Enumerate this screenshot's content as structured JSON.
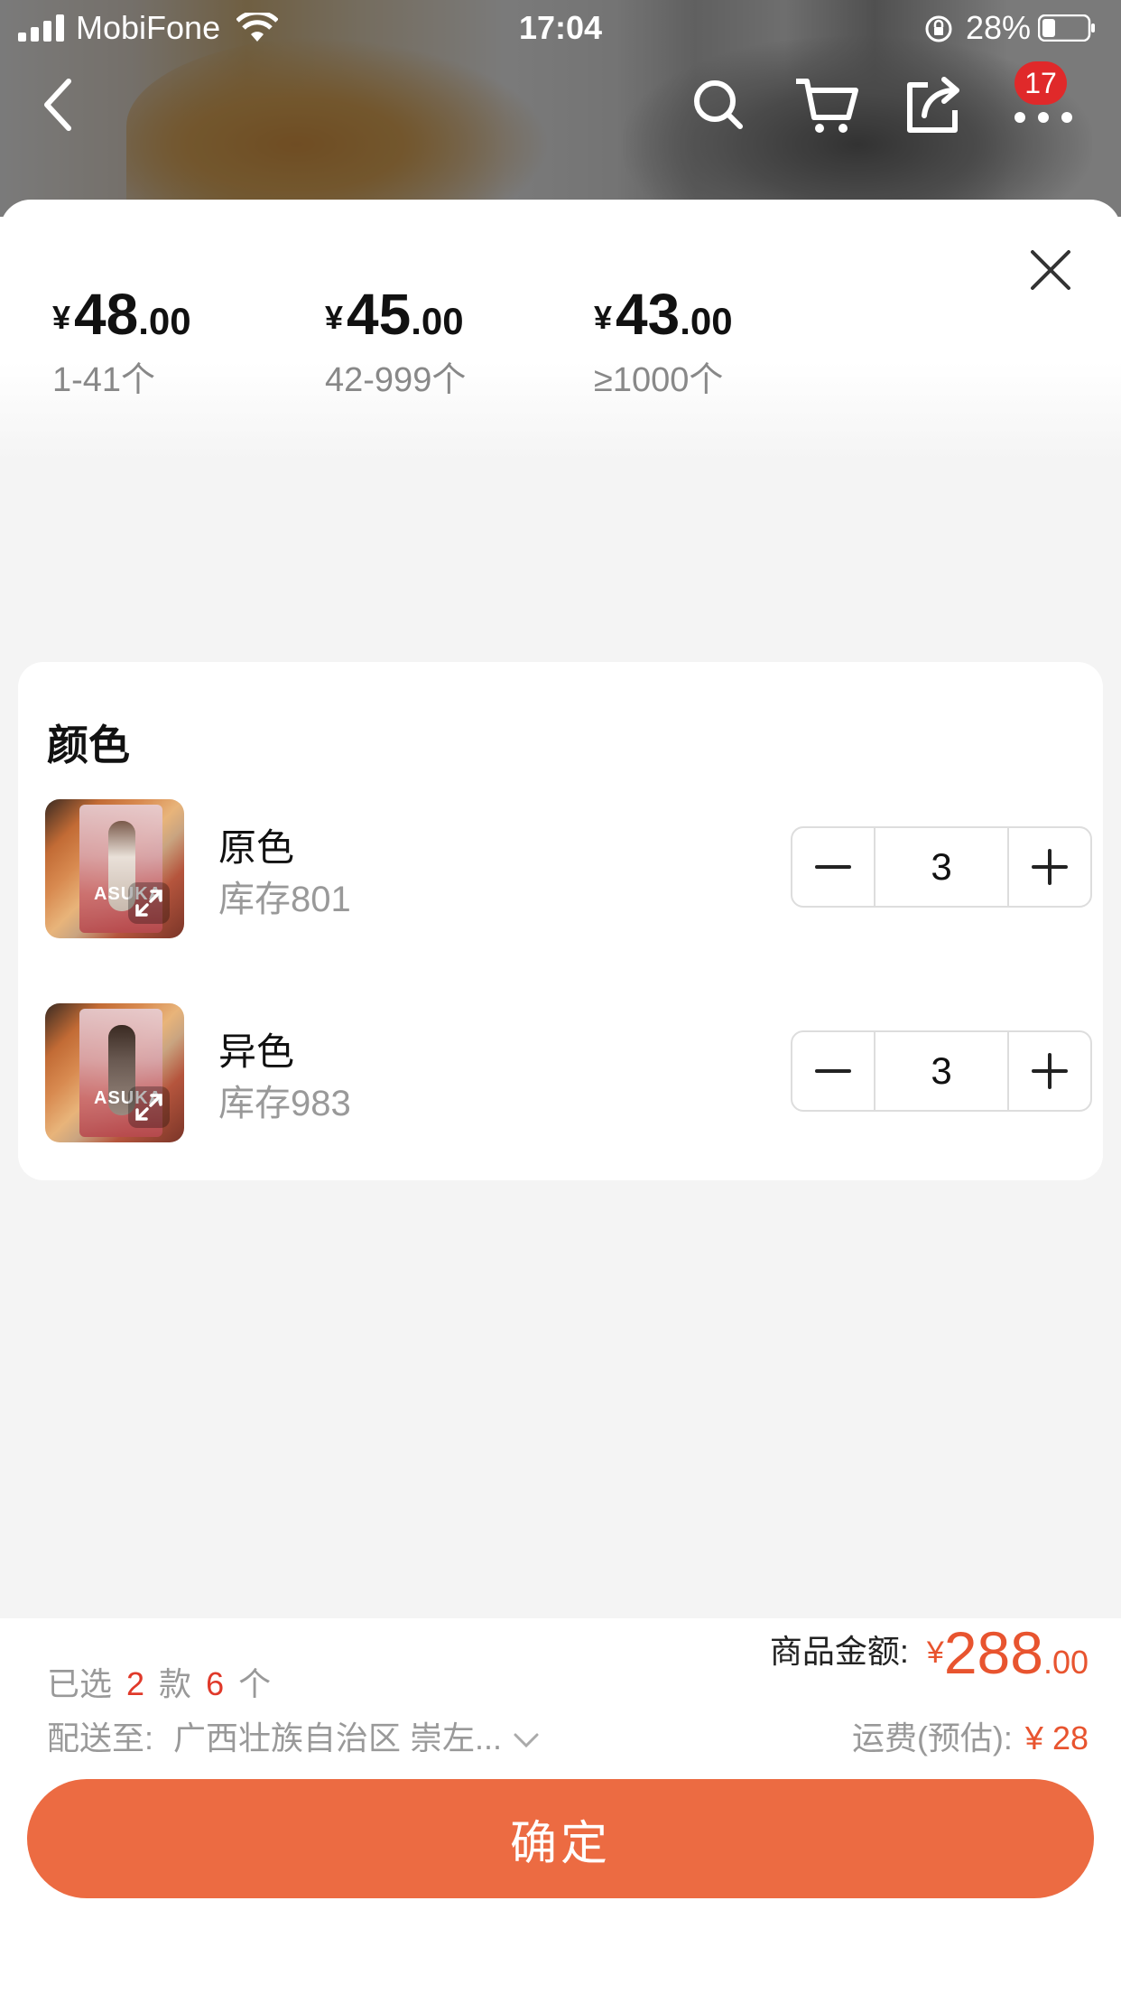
{
  "status_bar": {
    "carrier": "MobiFone",
    "time": "17:04",
    "battery": "28%"
  },
  "nav": {
    "cart_badge": "17"
  },
  "price_tiers": [
    {
      "currency": "¥",
      "integer": "48",
      "decimal": ".00",
      "range": "1-41个"
    },
    {
      "currency": "¥",
      "integer": "45",
      "decimal": ".00",
      "range": "42-999个"
    },
    {
      "currency": "¥",
      "integer": "43",
      "decimal": ".00",
      "range": "≥1000个"
    }
  ],
  "color_section": {
    "title": "颜色",
    "items": [
      {
        "name": "原色",
        "stock": "库存801",
        "quantity": "3",
        "thumb_text": "ASUKA"
      },
      {
        "name": "异色",
        "stock": "库存983",
        "quantity": "3",
        "thumb_text": "ASUKA"
      }
    ]
  },
  "summary": {
    "selected_prefix": "已选",
    "selected_styles": "2",
    "styles_unit": "款",
    "selected_count": "6",
    "count_unit": "个",
    "ship_label": "配送至:",
    "ship_address": "广西壮族自治区 崇左...",
    "amount_label": "商品金额:",
    "amount_currency": "¥",
    "amount_integer": "288",
    "amount_decimal": ".00",
    "fee_label": "运费(预估):",
    "fee_value": "¥ 28"
  },
  "confirm_label": "确定",
  "colors": {
    "accent": "#ec6b42",
    "price_red": "#e8542f",
    "badge_red": "#e0292a"
  }
}
